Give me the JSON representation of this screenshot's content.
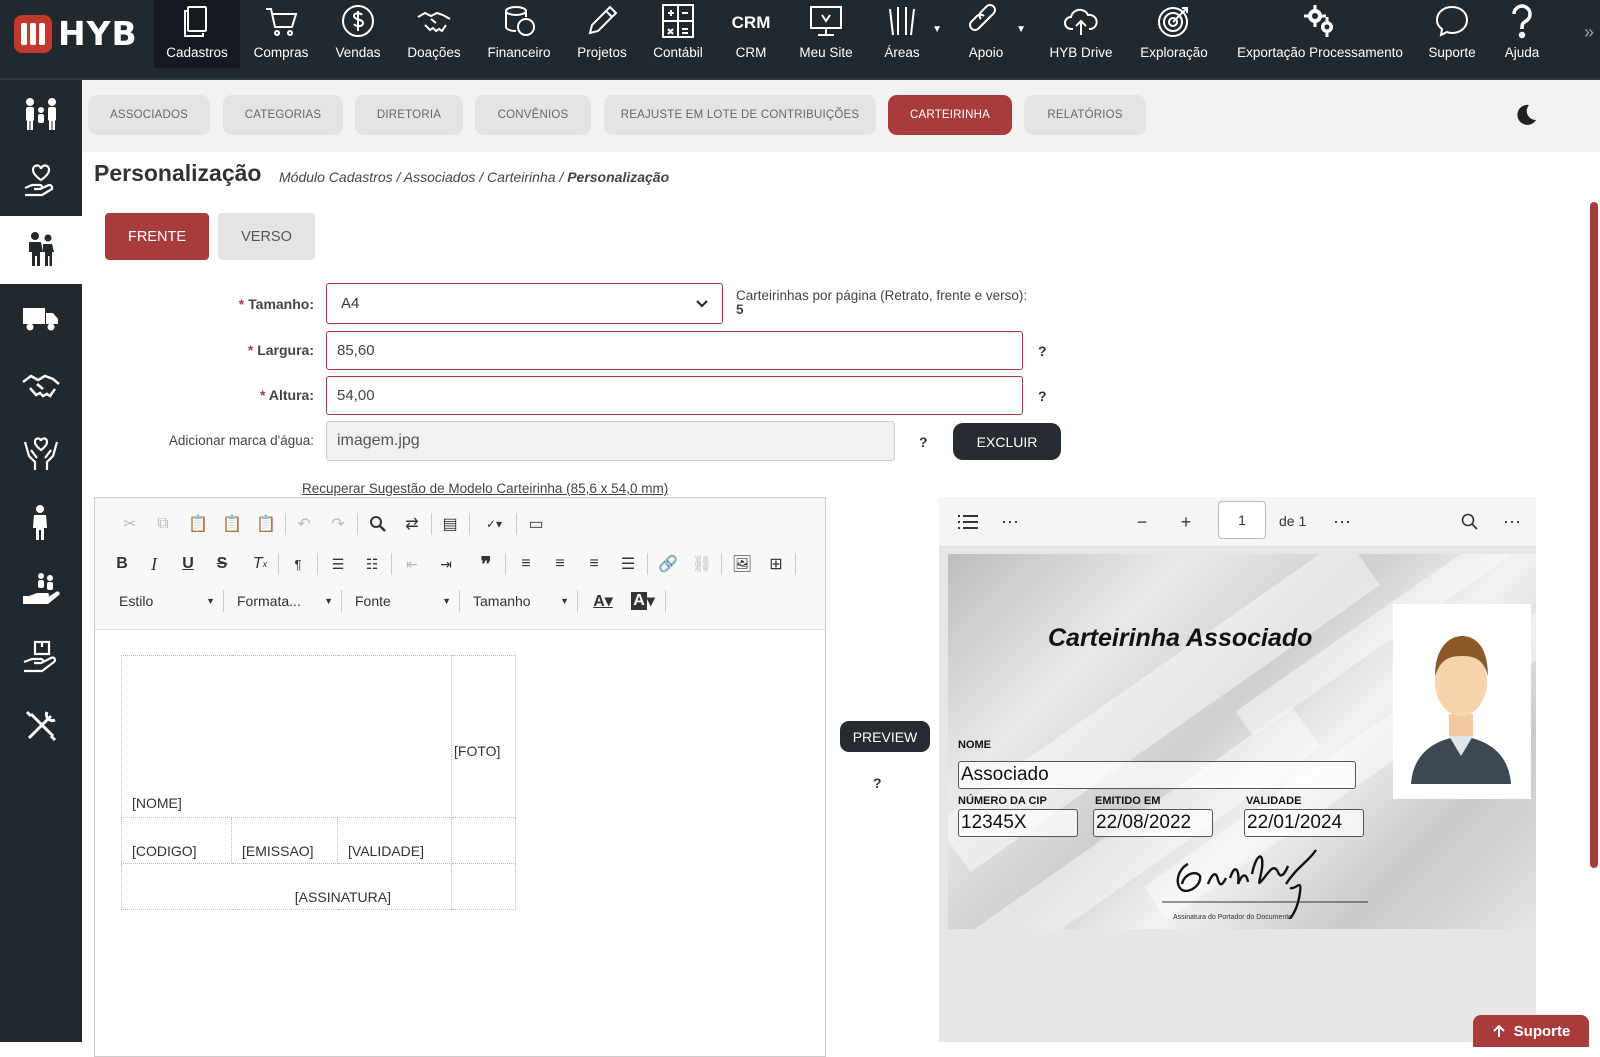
{
  "app": {
    "logo_text": "HYB",
    "brand_color": "#a83c3c"
  },
  "topnav": {
    "items": [
      {
        "label": "Cadastros",
        "icon": "copy-icon"
      },
      {
        "label": "Compras",
        "icon": "cart-icon"
      },
      {
        "label": "Vendas",
        "icon": "dollar-icon"
      },
      {
        "label": "Doações",
        "icon": "handshake-icon"
      },
      {
        "label": "Financeiro",
        "icon": "coins-icon"
      },
      {
        "label": "Projetos",
        "icon": "pencil-icon"
      },
      {
        "label": "Contábil",
        "icon": "calculator-icon"
      },
      {
        "label": "CRM",
        "icon": "crm-text"
      },
      {
        "label": "Meu Site",
        "icon": "monitor-icon"
      },
      {
        "label": "Áreas",
        "icon": "areas-icon"
      },
      {
        "label": "Apoio",
        "icon": "link-icon"
      },
      {
        "label": "HYB Drive",
        "icon": "cloud-upload-icon"
      },
      {
        "label": "Exploração",
        "icon": "target-icon"
      },
      {
        "label": "Exportação Processamento",
        "icon": "gears-icon"
      },
      {
        "label": "Suporte",
        "icon": "chat-icon"
      },
      {
        "label": "Ajuda",
        "icon": "question-icon"
      }
    ],
    "crm_glyph": "CRM",
    "more": "»"
  },
  "subnav": {
    "tabs": [
      "ASSOCIADOS",
      "CATEGORIAS",
      "DIRETORIA",
      "CONVÊNIOS",
      "REAJUSTE EM LOTE DE CONTRIBUIÇÕES",
      "CARTEIRINHA",
      "RELATÓRIOS"
    ],
    "active": "CARTEIRINHA"
  },
  "page": {
    "title": "Personalização",
    "breadcrumb": [
      "Módulo Cadastros",
      "Associados",
      "Carteirinha"
    ],
    "breadcrumb_current": "Personalização",
    "sep": " / "
  },
  "sides": {
    "front": "FRENTE",
    "back": "VERSO"
  },
  "form": {
    "required_mark": "*",
    "size_label": "Tamanho:",
    "size_value": "A4",
    "per_page_label": "Carteirinhas por página (Retrato, frente e verso):",
    "per_page_value": "5",
    "width_label": "Largura:",
    "width_value": "85,60",
    "height_label": "Altura:",
    "height_value": "54,00",
    "watermark_label": "Adicionar marca d'água:",
    "watermark_value": "imagem.jpg",
    "help": "?",
    "delete_label": "EXCLUIR",
    "suggest_link": "Recuperar Sugestão de Modelo Carteirinha (85,6 x 54,0 mm)"
  },
  "editor": {
    "combos": [
      "Estilo",
      "Formata...",
      "Fonte",
      "Tamanho"
    ],
    "template": {
      "foto": "[FOTO]",
      "nome": "[NOME]",
      "codigo": "[CODIGO]",
      "emissao": "[EMISSAO]",
      "validade": "[VALIDADE]",
      "assinatura": "[ASSINATURA]"
    }
  },
  "preview": {
    "label": "PREVIEW",
    "help": "?"
  },
  "viewer": {
    "page": "1",
    "of": "de 1"
  },
  "card": {
    "title": "Carteirinha Associado",
    "name_label": "NOME",
    "name_value": "Associado",
    "cip_label": "NÚMERO DA CIP",
    "cip_value": "12345X",
    "issued_label": "EMITIDO EM",
    "issued_value": "22/08/2022",
    "valid_label": "VALIDADE",
    "valid_value": "22/01/2024",
    "signature_caption": "Assinatura do Portador do Documento"
  },
  "support_button": "Suporte"
}
